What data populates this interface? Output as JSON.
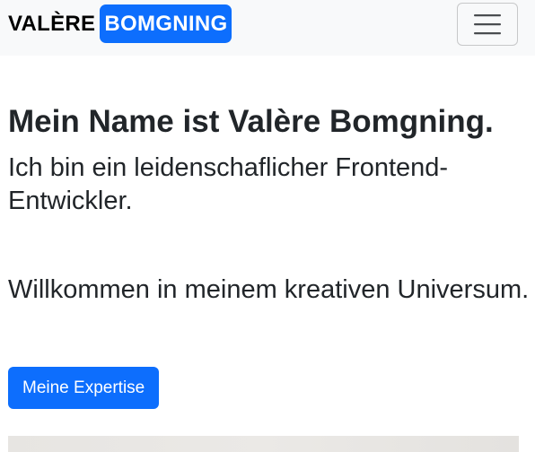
{
  "navbar": {
    "brand_first": "VALÈRE",
    "brand_badge": "BOMGNING",
    "toggler_icon": "hamburger-menu-icon",
    "toggler_aria": "Toggle navigation"
  },
  "hero": {
    "headline": "Mein Name ist Valère Bomgning.",
    "subline": "Ich bin ein leidenschaflicher Frontend-Entwickler.",
    "welcome": "Willkommen in meinem kreativen Universum.",
    "cta_label": "Meine Expertise"
  },
  "colors": {
    "primary": "#0d6efd",
    "navbar_bg": "#f8f9fa",
    "text": "#212529"
  }
}
